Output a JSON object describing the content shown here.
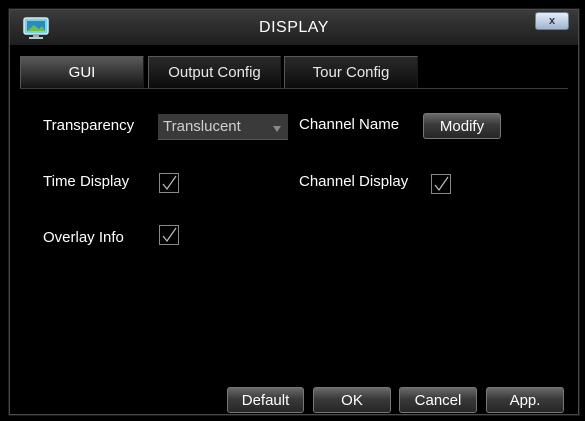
{
  "window": {
    "title": "DISPLAY",
    "close_label": "x"
  },
  "tabs": [
    {
      "label": "GUI",
      "active": true
    },
    {
      "label": "Output Config",
      "active": false
    },
    {
      "label": "Tour Config",
      "active": false
    }
  ],
  "gui": {
    "transparency_label": "Transparency",
    "transparency_value": "Translucent",
    "channel_name_label": "Channel Name",
    "modify_label": "Modify",
    "time_display_label": "Time Display",
    "time_display_checked": true,
    "channel_display_label": "Channel Display",
    "channel_display_checked": true,
    "overlay_info_label": "Overlay Info",
    "overlay_info_checked": true
  },
  "footer": {
    "default_label": "Default",
    "ok_label": "OK",
    "cancel_label": "Cancel",
    "apply_label": "App."
  },
  "colors": {
    "background": "#000000",
    "titlebar": "#2c2c2c",
    "text": "#ffffff",
    "select_bg": "#3a3a3a",
    "checkbox_border": "#8a8a8a"
  }
}
